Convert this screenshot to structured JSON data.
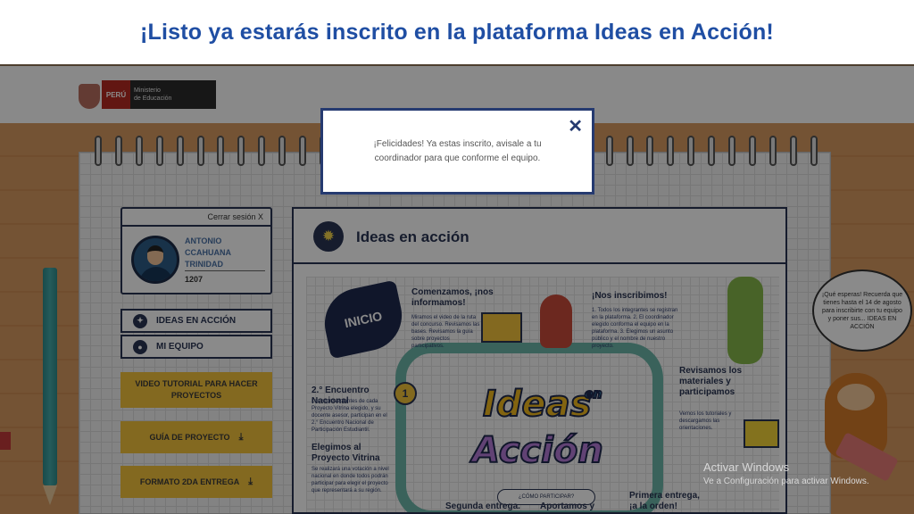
{
  "slide_title": "¡Listo ya estarás inscrito en la plataforma Ideas en Acción!",
  "logo": {
    "country": "PERÚ",
    "ministry_line1": "Ministerio",
    "ministry_line2": "de Educación"
  },
  "user": {
    "logout": "Cerrar sesión X",
    "name": "ANTONIO CCAHUANA TRINIDAD",
    "code": "1207"
  },
  "nav": {
    "ideas": "IDEAS EN ACCIÓN",
    "team": "MI EQUIPO"
  },
  "buttons": {
    "video": "VIDEO TUTORIAL PARA HACER PROYECTOS",
    "guide": "GUÍA DE PROYECTO",
    "format": "FORMATO 2DA ENTREGA"
  },
  "panel": {
    "title": "Ideas en acción"
  },
  "infographic": {
    "inicio": "INICIO",
    "comenzamos": "Comenzamos, ¡nos informamos!",
    "comenzamos_text": "Miramos el video de la ruta del concurso. Revisamos las bases. Revisamos la guía sobre proyectos participativos.",
    "inscribimos": "¡Nos inscribimos!",
    "inscribimos_text": "1. Todos los integrantes se registran en la plataforma. 2. El coordinador elegido conforma el equipo en la plataforma. 3. Elegimos un asunto público y el nombre de nuestro proyecto.",
    "revisamos": "Revisamos los materiales y participamos",
    "revisamos_text": "Vemos los tutoriales y descargamos las orientaciones.",
    "encuentro": "2.° Encuentro Nacional",
    "encuentro_text": "Los representantes de cada Proyecto Vitrina elegido, y su docente asesor, participan en el 2.° Encuentro Nacional de Participación Estudiantil.",
    "vitrina": "Elegimos al Proyecto Vitrina",
    "vitrina_text": "Se realizará una votación a nivel nacional en donde todos podrán participar para elegir el proyecto que representará a su región.",
    "logo_word1": "Ideas",
    "logo_word_en": "en",
    "logo_word2": "Acción",
    "como": "¿CÓMO PARTICIPAR?",
    "segunda": "Segunda entrega.",
    "aportamos": "Aportamos y",
    "primera": "Primera entrega, ¡a la orden!",
    "medal": "1"
  },
  "speech": "¡Qué esperas! Recuerda que tienes hasta el 14 de agosto para inscribirte con tu equipo y poner sus... IDEAS EN ACCIÓN",
  "modal": {
    "message": "¡Felicidades! Ya estas inscrito, avisale a tu coordinador para que conforme el equipo.",
    "close": "✕"
  },
  "watermark": {
    "line1": "Activar Windows",
    "line2": "Ve a Configuración para activar Windows."
  },
  "colors": {
    "title_blue": "#1f4ea3",
    "navy": "#2a3553",
    "yellow_button": "#f2c23c",
    "desk": "#d2935b"
  },
  "icons": [
    "bulb-icon",
    "download-icon",
    "close-icon",
    "lightbulb-nav-icon",
    "team-icon"
  ]
}
